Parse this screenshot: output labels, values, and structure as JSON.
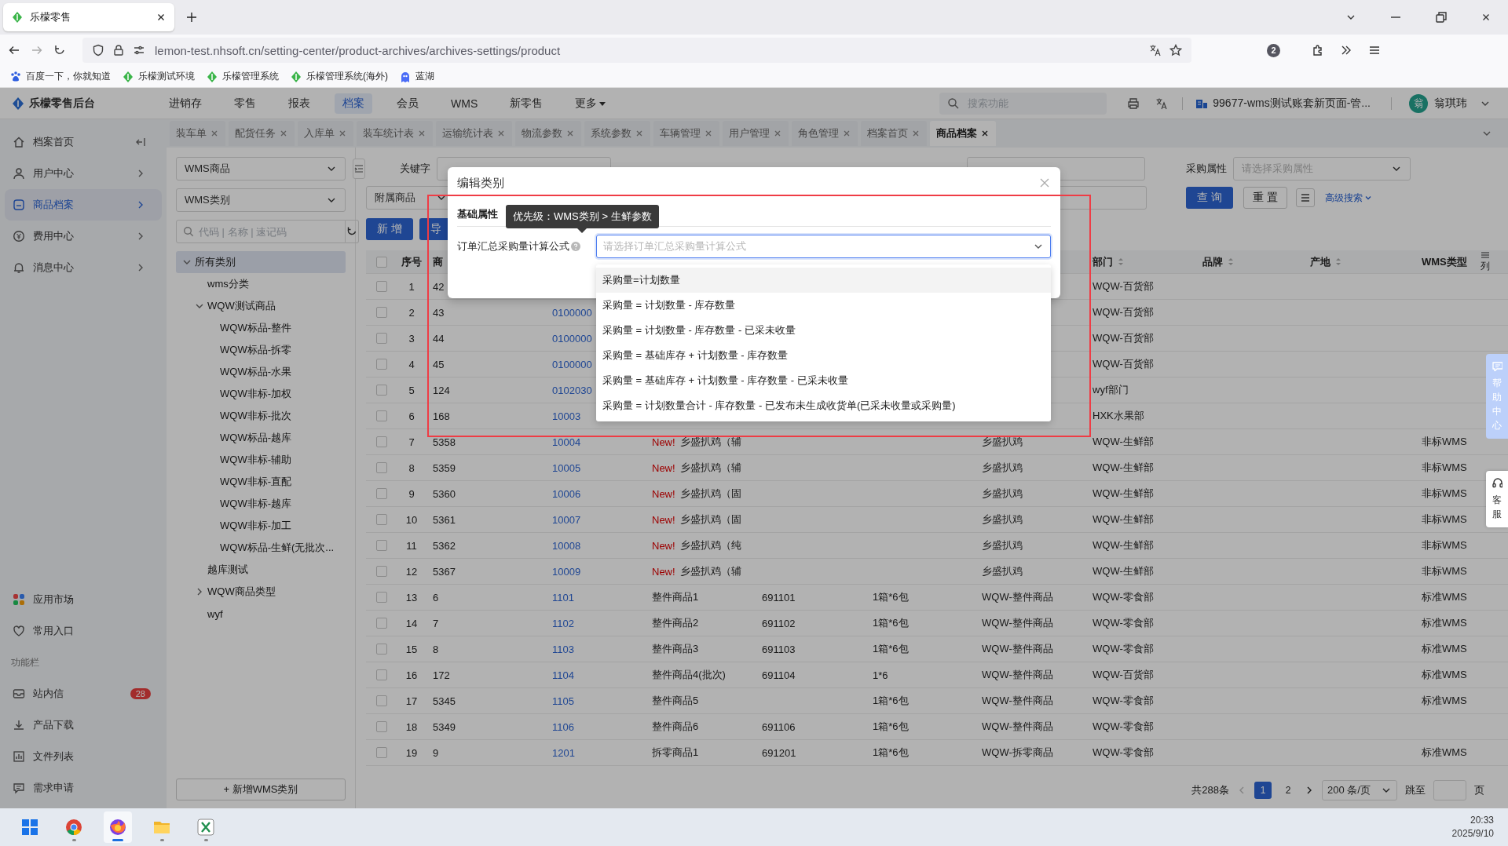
{
  "browser": {
    "tab_title": "乐檬零售",
    "url": "lemon-test.nhsoft.cn/setting-center/product-archives/archives-settings/product",
    "extension_count": "2",
    "bookmarks": [
      {
        "label": "百度一下，你就知道"
      },
      {
        "label": "乐檬测试环境"
      },
      {
        "label": "乐檬管理系统"
      },
      {
        "label": "乐檬管理系统(海外)"
      },
      {
        "label": "蓝湖"
      }
    ]
  },
  "header": {
    "logo": "乐檬零售后台",
    "nav": [
      {
        "label": "进销存",
        "selected": false
      },
      {
        "label": "零售",
        "selected": false
      },
      {
        "label": "报表",
        "selected": false
      },
      {
        "label": "档案",
        "selected": true
      },
      {
        "label": "会员",
        "selected": false
      },
      {
        "label": "WMS",
        "selected": false
      },
      {
        "label": "新零售",
        "selected": false
      }
    ],
    "more": "更多",
    "search_placeholder": "搜索功能",
    "account": "99677-wms测试账套新页面-管...",
    "avatar": "翁",
    "user": "翁琪玮"
  },
  "sidebar": {
    "items": [
      {
        "label": "档案首页",
        "selected": false
      },
      {
        "label": "用户中心",
        "selected": false
      },
      {
        "label": "商品档案",
        "selected": true
      },
      {
        "label": "费用中心",
        "selected": false
      },
      {
        "label": "消息中心",
        "selected": false
      }
    ],
    "shortcuts": [
      {
        "label": "应用市场"
      },
      {
        "label": "常用入口"
      }
    ],
    "section": "功能栏",
    "tools": [
      {
        "label": "站内信",
        "badge": "28"
      },
      {
        "label": "产品下载"
      },
      {
        "label": "文件列表"
      },
      {
        "label": "需求申请"
      }
    ]
  },
  "page_tabs": [
    {
      "label": "装车单",
      "selected": false
    },
    {
      "label": "配货任务",
      "selected": false
    },
    {
      "label": "入库单",
      "selected": false
    },
    {
      "label": "装车统计表",
      "selected": false
    },
    {
      "label": "运输统计表",
      "selected": false
    },
    {
      "label": "物流参数",
      "selected": false
    },
    {
      "label": "系统参数",
      "selected": false
    },
    {
      "label": "车辆管理",
      "selected": false
    },
    {
      "label": "用户管理",
      "selected": false
    },
    {
      "label": "角色管理",
      "selected": false
    },
    {
      "label": "档案首页",
      "selected": false
    },
    {
      "label": "商品档案",
      "selected": true
    }
  ],
  "category_panel": {
    "source": "WMS商品",
    "type": "WMS类别",
    "search_placeholder": "代码 | 名称 | 速记码",
    "tree": [
      {
        "label": "所有类别",
        "expanded": true,
        "selected": true,
        "children": [
          {
            "label": "wms分类",
            "selected": false
          },
          {
            "label": "WQW测试商品",
            "expanded": true,
            "selected": false,
            "children": [
              {
                "label": "WQW标品-整件",
                "selected": false
              },
              {
                "label": "WQW标品-拆零",
                "selected": false
              },
              {
                "label": "WQW标品-水果",
                "selected": false
              },
              {
                "label": "WQW非标-加权",
                "selected": false
              },
              {
                "label": "WQW非标-批次",
                "selected": false
              },
              {
                "label": "WQW标品-越库",
                "selected": false
              },
              {
                "label": "WQW非标-辅助",
                "selected": false
              },
              {
                "label": "WQW非标-直配",
                "selected": false
              },
              {
                "label": "WQW非标-越库",
                "selected": false
              },
              {
                "label": "WQW非标-加工",
                "selected": false
              },
              {
                "label": "WQW标品-生鲜(无批次...",
                "selected": false
              }
            ]
          },
          {
            "label": "越库测试",
            "selected": false
          },
          {
            "label": "WQW商品类型",
            "expanded": false,
            "selected": false
          },
          {
            "label": "wyf",
            "selected": false
          }
        ]
      }
    ],
    "add_button": "+ 新增WMS类别"
  },
  "filters": {
    "keyword_label": "关键字",
    "purchase_label": "采购属性",
    "purchase_placeholder": "请选择采购属性",
    "attached": "附属商品",
    "query_button": "查 询",
    "reset_button": "重 置",
    "advanced_link": "高级搜索"
  },
  "actions": [
    {
      "label": "新 增",
      "primary": true
    },
    {
      "label": "导",
      "primary": true
    }
  ],
  "table": {
    "all_checked": false,
    "header": {
      "index": {
        "label": "序号"
      },
      "id": {
        "label": "商"
      },
      "dept": {
        "label": "部门",
        "sortable": true
      },
      "brand": {
        "label": "品牌",
        "sortable": true
      },
      "origin": {
        "label": "产地",
        "sortable": true
      },
      "wms_type": {
        "label": "WMS类型"
      }
    },
    "column_settings": "列",
    "rows": [
      {
        "checked": false,
        "index": "1",
        "id": "42",
        "dept": "WQW-百货部"
      },
      {
        "checked": false,
        "index": "2",
        "id": "43",
        "code": "0100000",
        "dept": "WQW-百货部"
      },
      {
        "checked": false,
        "index": "3",
        "id": "44",
        "code": "0100000",
        "dept": "WQW-百货部"
      },
      {
        "checked": false,
        "index": "4",
        "id": "45",
        "code": "0100000",
        "dept": "WQW-百货部"
      },
      {
        "checked": false,
        "index": "5",
        "id": "124",
        "code": "0102030",
        "dept": "wyf部门"
      },
      {
        "checked": false,
        "index": "6",
        "id": "168",
        "code": "10003",
        "dept": "HXK水果部"
      },
      {
        "checked": false,
        "index": "7",
        "id": "5358",
        "code": "10004",
        "badge": "New!",
        "name": "乡盛扒鸡（辅",
        "category": "乡盛扒鸡",
        "dept": "WQW-生鲜部",
        "wms_type": "非标WMS"
      },
      {
        "checked": false,
        "index": "8",
        "id": "5359",
        "code": "10005",
        "badge": "New!",
        "name": "乡盛扒鸡（辅",
        "category": "乡盛扒鸡",
        "dept": "WQW-生鲜部",
        "wms_type": "非标WMS"
      },
      {
        "checked": false,
        "index": "9",
        "id": "5360",
        "code": "10006",
        "badge": "New!",
        "name": "乡盛扒鸡（固",
        "category": "乡盛扒鸡",
        "dept": "WQW-生鲜部",
        "wms_type": "非标WMS"
      },
      {
        "checked": false,
        "index": "10",
        "id": "5361",
        "code": "10007",
        "badge": "New!",
        "name": "乡盛扒鸡（固",
        "category": "乡盛扒鸡",
        "dept": "WQW-生鲜部",
        "wms_type": "非标WMS"
      },
      {
        "checked": false,
        "index": "11",
        "id": "5362",
        "code": "10008",
        "badge": "New!",
        "name": "乡盛扒鸡（纯",
        "category": "乡盛扒鸡",
        "dept": "WQW-生鲜部",
        "wms_type": "非标WMS"
      },
      {
        "checked": false,
        "index": "12",
        "id": "5367",
        "code": "10009",
        "badge": "New!",
        "name": "乡盛扒鸡（辅",
        "category": "乡盛扒鸡",
        "dept": "WQW-生鲜部",
        "wms_type": "非标WMS"
      },
      {
        "checked": false,
        "index": "13",
        "id": "6",
        "code": "1101",
        "name": "整件商品1",
        "barcode": "691101",
        "spec": "1箱*6包",
        "category": "WQW-整件商品",
        "dept": "WQW-零食部",
        "wms_type": "标准WMS"
      },
      {
        "checked": false,
        "index": "14",
        "id": "7",
        "code": "1102",
        "name": "整件商品2",
        "barcode": "691102",
        "spec": "1箱*6包",
        "category": "WQW-整件商品",
        "dept": "WQW-零食部",
        "wms_type": "标准WMS"
      },
      {
        "checked": false,
        "index": "15",
        "id": "8",
        "code": "1103",
        "name": "整件商品3",
        "barcode": "691103",
        "spec": "1箱*6包",
        "category": "WQW-整件商品",
        "dept": "WQW-零食部",
        "wms_type": "标准WMS"
      },
      {
        "checked": false,
        "index": "16",
        "id": "172",
        "code": "1104",
        "name": "整件商品4(批次)",
        "barcode": "691104",
        "spec": "1*6",
        "category": "WQW-整件商品",
        "dept": "WQW-百货部",
        "wms_type": "标准WMS"
      },
      {
        "checked": false,
        "index": "17",
        "id": "5345",
        "code": "1105",
        "name": "整件商品5",
        "spec": "1箱*6包",
        "category": "WQW-整件商品",
        "dept": "WQW-零食部",
        "wms_type": "标准WMS"
      },
      {
        "checked": false,
        "index": "18",
        "id": "5349",
        "code": "1106",
        "name": "整件商品6",
        "barcode": "691106",
        "spec": "1箱*6包",
        "category": "WQW-整件商品",
        "dept": "WQW-零食部"
      },
      {
        "checked": false,
        "index": "19",
        "id": "9",
        "code": "1201",
        "name": "拆零商品1",
        "barcode": "691201",
        "spec": "1箱*6包",
        "category": "WQW-拆零商品",
        "dept": "WQW-零食部",
        "wms_type": "标准WMS"
      }
    ]
  },
  "pagination": {
    "total": "共288条",
    "pages": [
      {
        "label": "1",
        "selected": true
      },
      {
        "label": "2",
        "selected": false
      }
    ],
    "page_size": "200 条/页",
    "jump_label": "跳至",
    "page_label": "页"
  },
  "modal": {
    "title": "编辑类别",
    "tabs": [
      {
        "label": "基础属性",
        "selected": true
      }
    ],
    "tooltip": "优先级：WMS类别 > 生鲜参数",
    "field_label": "订单汇总采购量计算公式",
    "placeholder": "请选择订单汇总采购量计算公式",
    "options": [
      {
        "label": "采购量=计划数量",
        "highlighted": true
      },
      {
        "label": "采购量 = 计划数量 - 库存数量",
        "highlighted": false
      },
      {
        "label": "采购量 = 计划数量 - 库存数量 - 已采未收量",
        "highlighted": false
      },
      {
        "label": "采购量 = 基础库存 + 计划数量 - 库存数量",
        "highlighted": false
      },
      {
        "label": "采购量 = 基础库存 + 计划数量 - 库存数量 - 已采未收量",
        "highlighted": false
      },
      {
        "label": "采购量 = 计划数量合计 - 库存数量 - 已发布未生成收货单(已采未收量或采购量)",
        "highlighted": false
      }
    ]
  },
  "side_tabs": [
    {
      "label": "帮助中心",
      "kind": "help"
    },
    {
      "label": "客服",
      "kind": "service"
    }
  ],
  "taskbar": {
    "apps": [
      {
        "active": false
      },
      {
        "active": true
      },
      {
        "active": false
      },
      {
        "active": false
      }
    ],
    "time": "20:33",
    "date": "2025/9/10"
  }
}
